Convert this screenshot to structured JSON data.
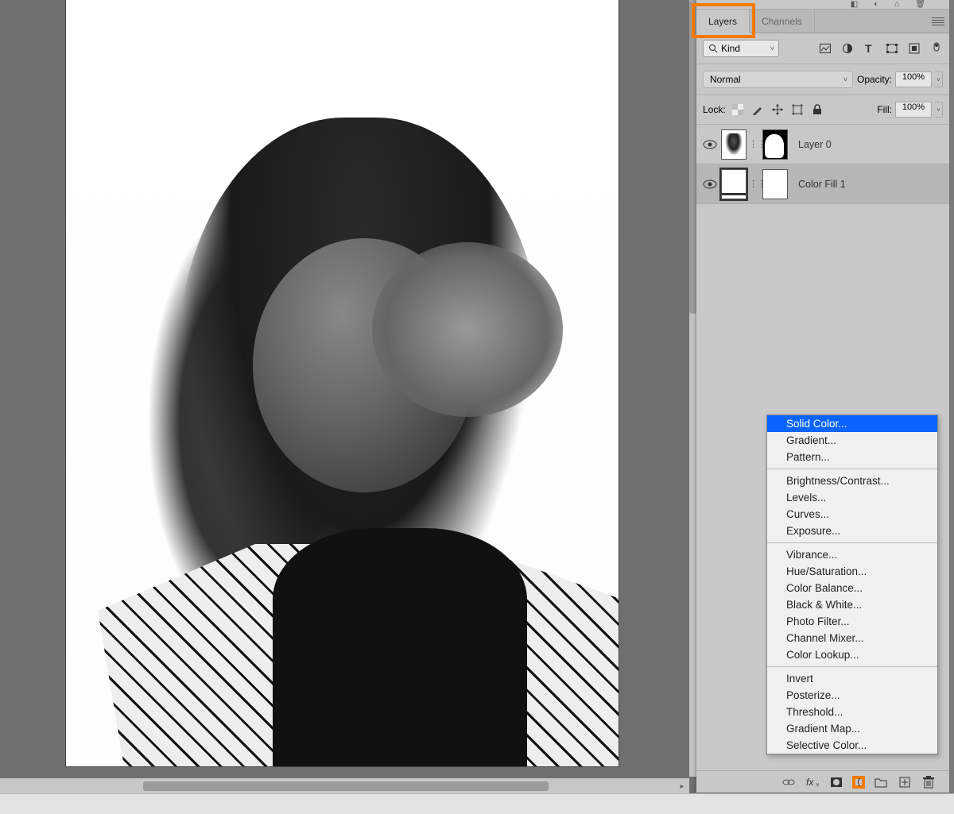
{
  "tabs": {
    "layers": "Layers",
    "channels": "Channels"
  },
  "filterRow": {
    "kind": "Kind"
  },
  "blendRow": {
    "mode": "Normal",
    "opacityLabel": "Opacity:",
    "opacityVal": "100%"
  },
  "lockRow": {
    "label": "Lock:",
    "fillLabel": "Fill:",
    "fillVal": "100%"
  },
  "layers": [
    {
      "name": "Layer 0"
    },
    {
      "name": "Color Fill 1"
    }
  ],
  "menu": {
    "group1": [
      "Solid Color...",
      "Gradient...",
      "Pattern..."
    ],
    "group2": [
      "Brightness/Contrast...",
      "Levels...",
      "Curves...",
      "Exposure..."
    ],
    "group3": [
      "Vibrance...",
      "Hue/Saturation...",
      "Color Balance...",
      "Black & White...",
      "Photo Filter...",
      "Channel Mixer...",
      "Color Lookup..."
    ],
    "group4": [
      "Invert",
      "Posterize...",
      "Threshold...",
      "Gradient Map...",
      "Selective Color..."
    ]
  }
}
